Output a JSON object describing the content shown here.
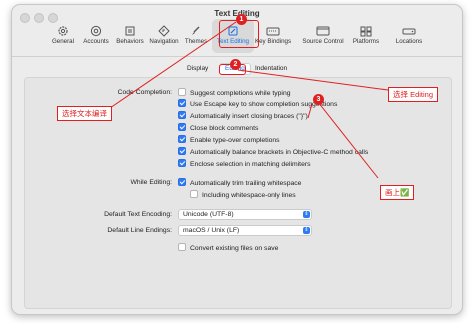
{
  "window": {
    "title": "Text Editing"
  },
  "toolbar": {
    "items": [
      {
        "label": "General",
        "icon": "gear-icon"
      },
      {
        "label": "Accounts",
        "icon": "at-icon"
      },
      {
        "label": "Behaviors",
        "icon": "behaviors-icon"
      },
      {
        "label": "Navigation",
        "icon": "navigation-icon"
      },
      {
        "label": "Themes",
        "icon": "brush-icon"
      },
      {
        "label": "Text Editing",
        "icon": "pencil-icon",
        "active": true
      },
      {
        "label": "Key Bindings",
        "icon": "keyboard-icon"
      },
      {
        "label": "Source Control",
        "icon": "source-control-icon"
      },
      {
        "label": "Platforms",
        "icon": "platforms-icon"
      },
      {
        "label": "Locations",
        "icon": "drive-icon"
      }
    ]
  },
  "subtabs": {
    "display": "Display",
    "editing": "Editing",
    "indentation": "Indentation"
  },
  "code_completion": {
    "label": "Code Completion:",
    "options": [
      {
        "label": "Suggest completions while typing",
        "checked": false
      },
      {
        "label": "Use Escape key to show completion suggestions",
        "checked": true
      },
      {
        "label": "Automatically insert closing braces (\"}\")",
        "checked": true
      },
      {
        "label": "Close block comments",
        "checked": true
      },
      {
        "label": "Enable type-over completions",
        "checked": true
      },
      {
        "label": "Automatically balance brackets in Objective-C method calls",
        "checked": true
      },
      {
        "label": "Enclose selection in matching delimiters",
        "checked": true
      }
    ]
  },
  "while_editing": {
    "label": "While Editing:",
    "options": [
      {
        "label": "Automatically trim trailing whitespace",
        "checked": true
      },
      {
        "label": "Including whitespace-only lines",
        "checked": false
      }
    ]
  },
  "default_encoding": {
    "label": "Default Text Encoding:",
    "value": "Unicode (UTF-8)"
  },
  "default_line_endings": {
    "label": "Default Line Endings:",
    "value": "macOS / Unix (LF)"
  },
  "convert_files": {
    "label": "Convert existing files on save",
    "checked": false
  },
  "annotations": {
    "badge1": "1",
    "badge2": "2",
    "badge3": "3",
    "select_text_editing": "选择文本编译",
    "select_editing": "选择 Editing",
    "check": "画上✅"
  },
  "colors": {
    "accent": "#2f7bf5",
    "annotation": "#e02020"
  }
}
